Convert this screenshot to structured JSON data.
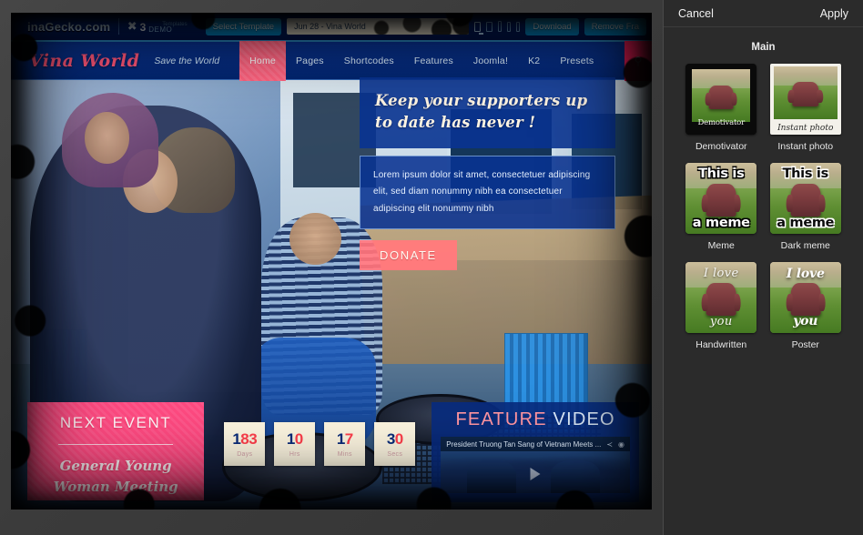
{
  "sidebar": {
    "cancel_label": "Cancel",
    "apply_label": "Apply",
    "section_title": "Main",
    "effects": [
      {
        "name": "Demotivator",
        "caption_top": "",
        "caption_bottom": "Demotivator"
      },
      {
        "name": "Instant photo",
        "caption_top": "",
        "caption_bottom": "Instant photo"
      },
      {
        "name": "Meme",
        "caption_top": "This is",
        "caption_bottom": "a meme"
      },
      {
        "name": "Dark meme",
        "caption_top": "This is",
        "caption_bottom": "a meme"
      },
      {
        "name": "Handwritten",
        "caption_top": "I love",
        "caption_bottom": "you"
      },
      {
        "name": "Poster",
        "caption_top": "I love",
        "caption_bottom": "you"
      }
    ]
  },
  "canvas": {
    "demo_bar": {
      "logo": "inaGecko.com",
      "templates_label": "Templates",
      "count": "3",
      "demo_label": "DEMO",
      "select_template_label": "Select Template",
      "selected_template": "Jun 28 - Vina World",
      "download_label": "Download",
      "remove_frame_label": "Remove Fra"
    },
    "site": {
      "brand": "Vina World",
      "tagline": "Save the World",
      "menu": [
        "Home",
        "Pages",
        "Shortcodes",
        "Features",
        "Joomla!",
        "K2",
        "Presets"
      ],
      "active_menu": "Home",
      "search_icon": "search-icon"
    },
    "hero": {
      "headline": "Keep your supporters up to date has never !",
      "body": "Lorem ipsum dolor sit amet, consectetuer adipiscing elit, sed diam nonummy nibh ea consectetuer adipiscing elit nonummy nibh",
      "donate_label": "DONATE"
    },
    "next_event": {
      "title": "NEXT EVENT",
      "subtitle": "General Young Woman Meeting"
    },
    "countdown": [
      {
        "value": "183",
        "label": "Days"
      },
      {
        "value": "10",
        "label": "Hrs"
      },
      {
        "value": "17",
        "label": "Mins"
      },
      {
        "value": "30",
        "label": "Secs"
      }
    ],
    "feature_video": {
      "title_a": "FEATURE",
      "title_b": "VIDEO",
      "video_title": "President Truong Tan Sang of Vietnam Meets ...",
      "share_icon": "share-icon",
      "watch_later_icon": "watch-later-icon",
      "play_icon": "play-icon"
    }
  },
  "colors": {
    "sidebar_bg": "#2b2b2b",
    "site_blue": "#15306f",
    "pink": "#ef6b80",
    "accent_red": "#ef4b55",
    "cream": "#f6f0e0"
  }
}
